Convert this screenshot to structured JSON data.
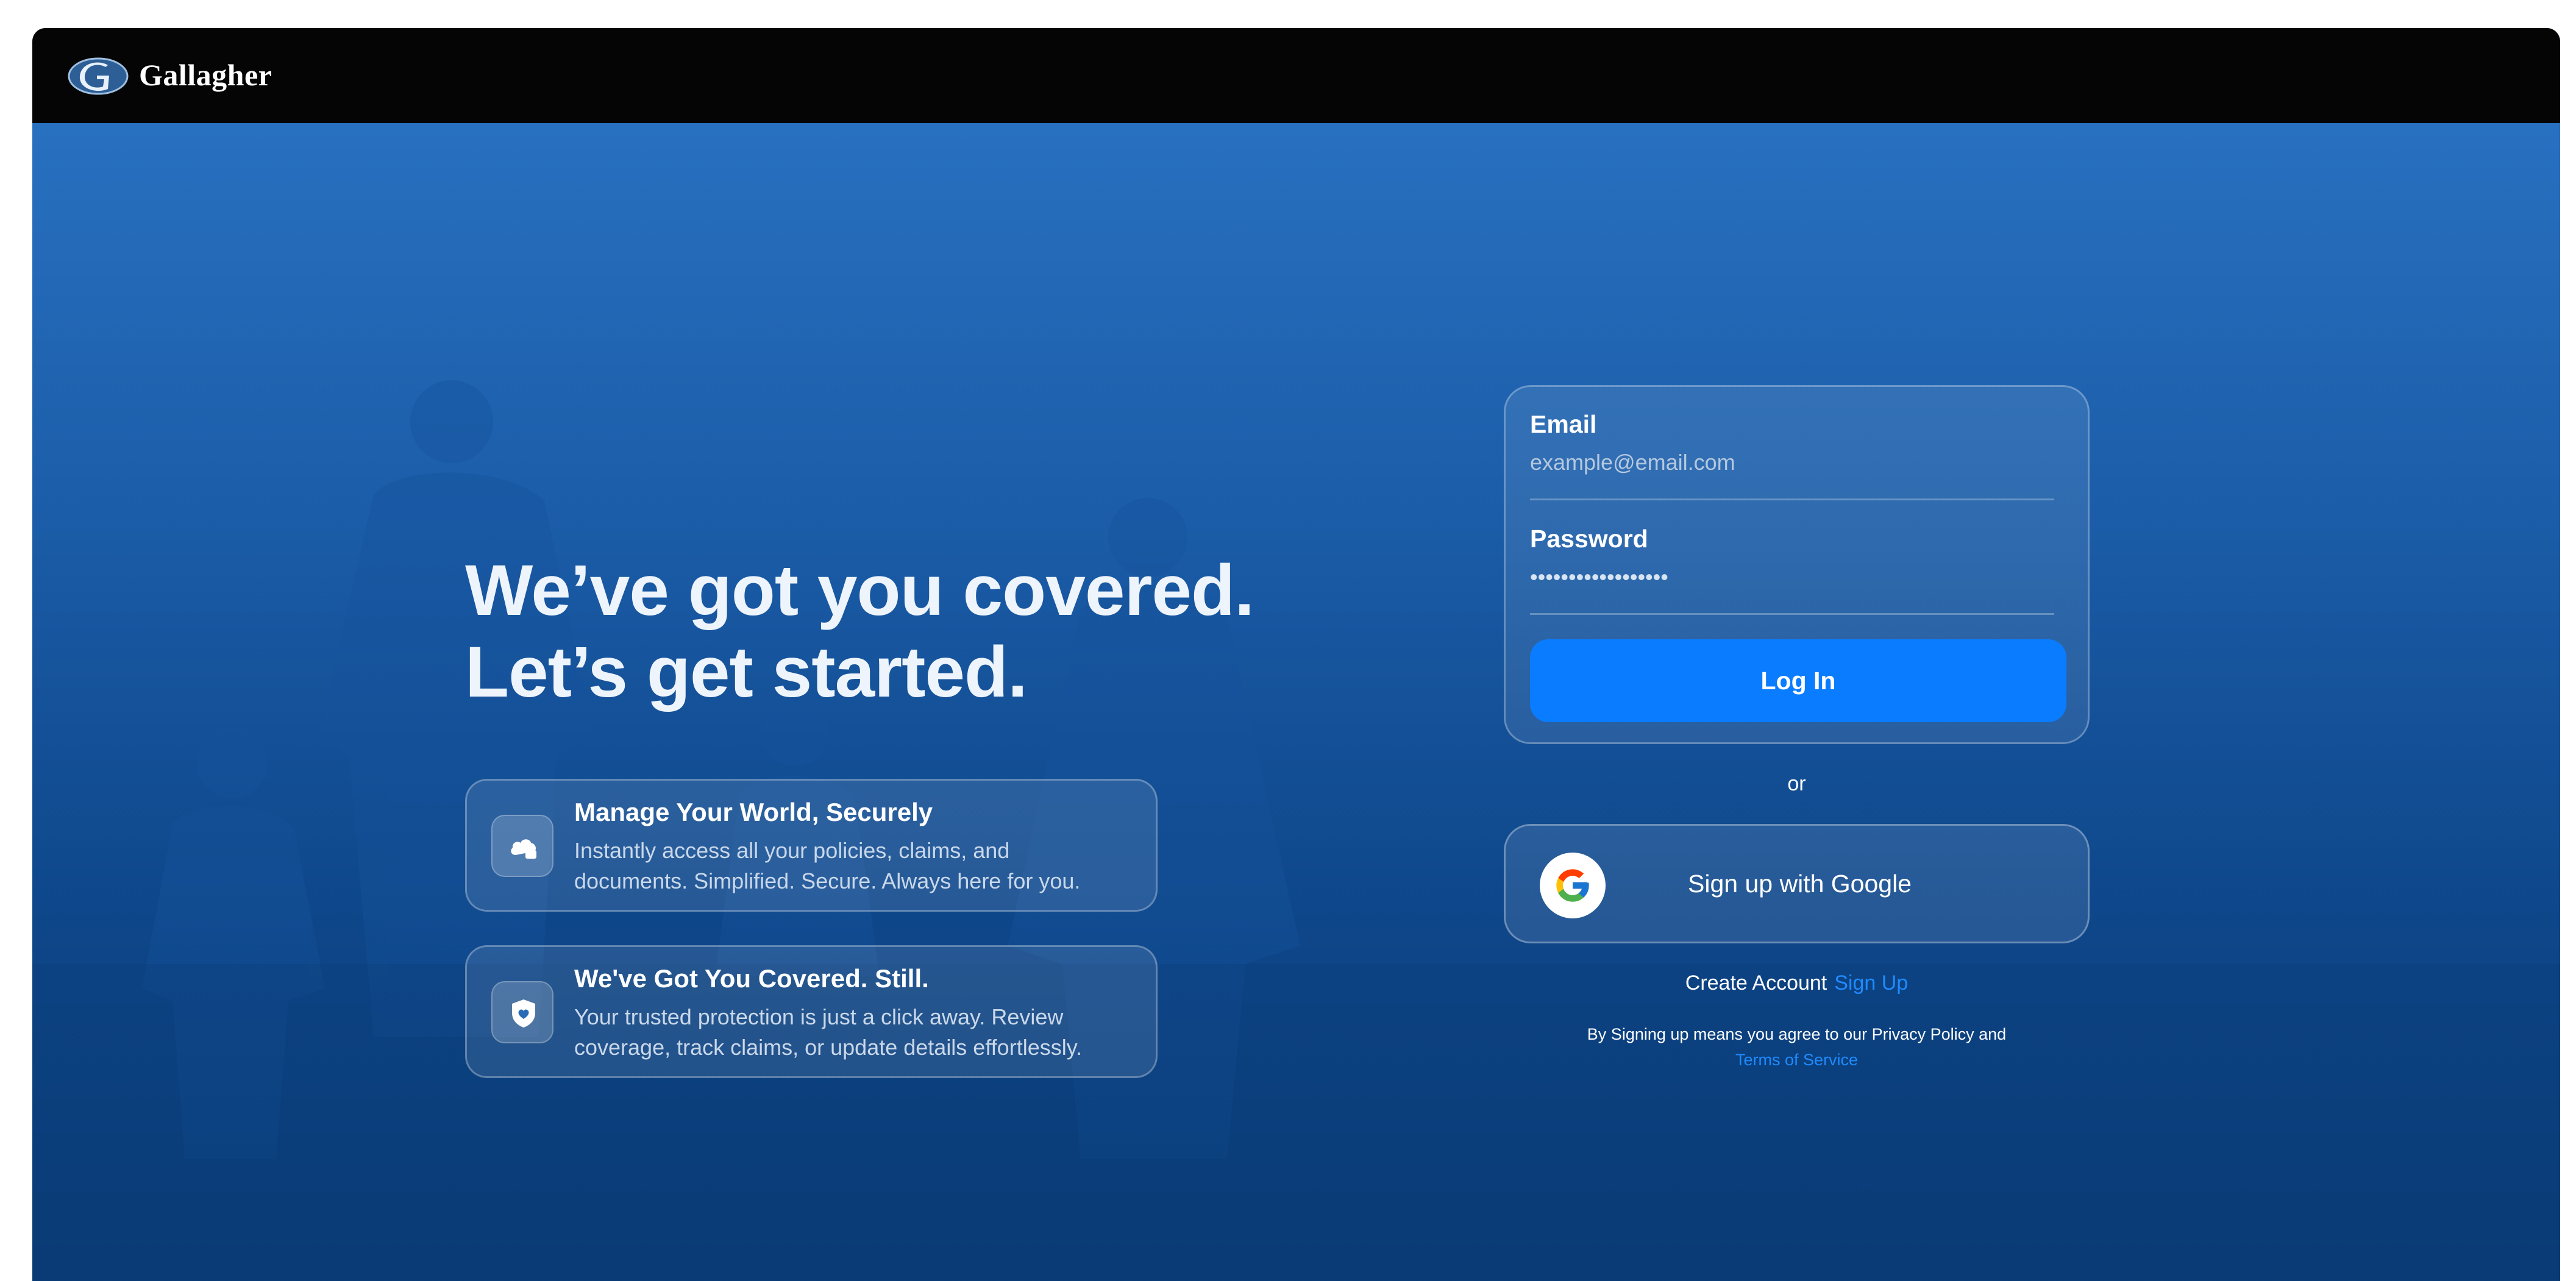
{
  "header": {
    "brand": "Gallagher",
    "logo_icon": "gallagher-logo-icon"
  },
  "hero": {
    "headline_line1": "We’ve got you covered.",
    "headline_line2": "Let’s get started.",
    "features": [
      {
        "icon": "cloud-lock-icon",
        "title": "Manage Your World, Securely",
        "description": "Instantly access all your policies, claims, and documents. Simplified. Secure. Always here for you."
      },
      {
        "icon": "shield-heart-icon",
        "title": "We've Got You Covered. Still.",
        "description": "Your trusted protection is just a click away. Review coverage, track claims, or update details effortlessly."
      }
    ]
  },
  "login": {
    "email_label": "Email",
    "email_placeholder": "example@email.com",
    "password_label": "Password",
    "password_value": "••••••••••••••••••",
    "login_button": "Log In",
    "or_text": "or",
    "google_button": "Sign up with Google",
    "create_account_text": "Create Account",
    "sign_up_link": "Sign Up",
    "legal_text": "By Signing up means you agree to our Privacy Policy and",
    "terms_link": "Terms of Service"
  },
  "colors": {
    "header_bg": "#050505",
    "primary_button": "#0a7cff",
    "link": "#1f8bff",
    "hero_gradient_top": "#2a74c4",
    "hero_gradient_bottom": "#0b3f7d"
  }
}
